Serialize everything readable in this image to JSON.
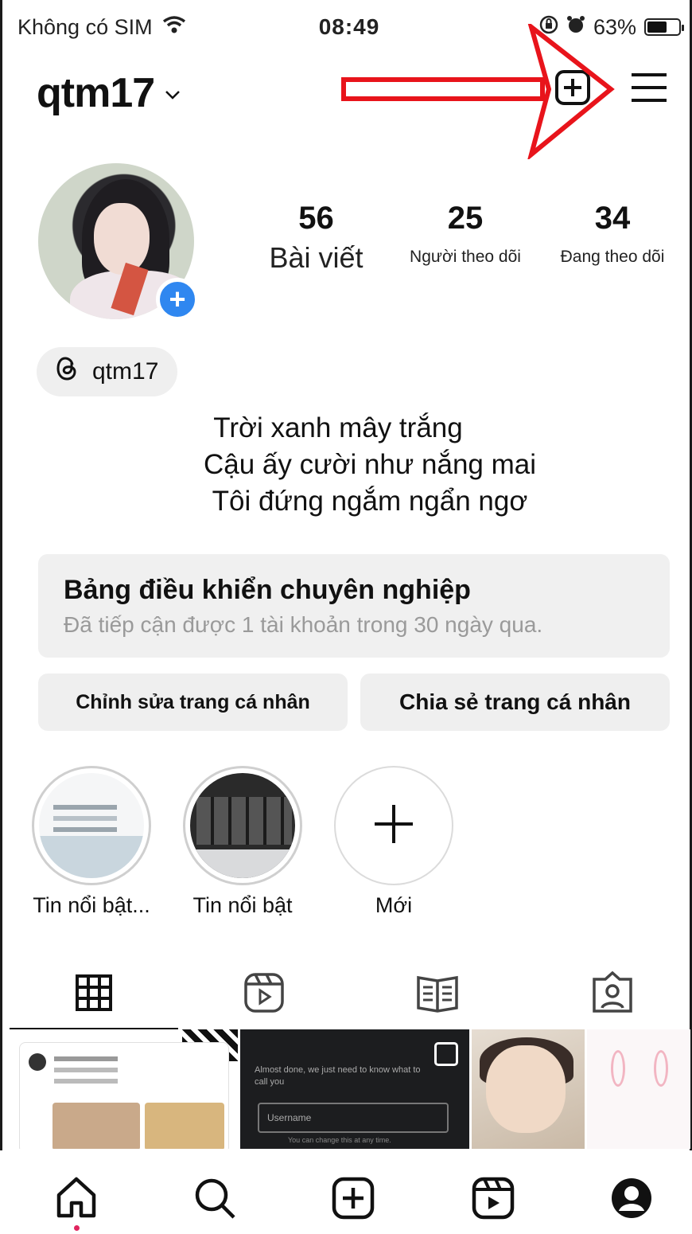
{
  "status_bar": {
    "carrier": "Không có SIM",
    "time": "08:49",
    "battery_percent": "63%",
    "battery_level": 0.63,
    "icons": [
      "wifi-icon",
      "orientation-lock-icon",
      "alarm-icon",
      "battery-icon"
    ]
  },
  "header": {
    "username": "qtm17",
    "icons": [
      "chevron-down-icon",
      "create-post-icon",
      "menu-icon"
    ]
  },
  "profile": {
    "stats": [
      {
        "value": "56",
        "label": "Bài viết"
      },
      {
        "value": "25",
        "label": "Người theo dõi"
      },
      {
        "value": "34",
        "label": "Đang theo dõi"
      }
    ],
    "threads_handle": "qtm17",
    "bio_lines": [
      "Trời xanh mây trắng",
      "Cậu ấy cười như nắng mai",
      "Tôi đứng ngắm ngẩn ngơ"
    ]
  },
  "dashboard": {
    "title": "Bảng điều khiển chuyên nghiệp",
    "subtitle": "Đã tiếp cận được 1 tài khoản trong 30 ngày qua."
  },
  "buttons": {
    "edit_profile": "Chỉnh sửa trang cá nhân",
    "share_profile": "Chia sẻ trang cá nhân"
  },
  "highlights": [
    {
      "label": "Tin nổi bật..."
    },
    {
      "label": "Tin nổi bật"
    },
    {
      "label": "Mới"
    }
  ],
  "tabs": [
    "grid-icon",
    "reels-icon",
    "guides-icon",
    "tagged-icon"
  ],
  "grid_post_text": {
    "post2_line": "Almost done, we just need to know what to call you",
    "post2_field": "Username",
    "post2_hint": "You can change this at any time."
  },
  "bottom_nav": [
    "home-icon",
    "search-icon",
    "new-post-icon",
    "reels-icon",
    "profile-icon"
  ],
  "colors": {
    "accent_blue": "#2f87f0",
    "annotation_red": "#e8141b",
    "notification_dot": "#e0245e"
  }
}
